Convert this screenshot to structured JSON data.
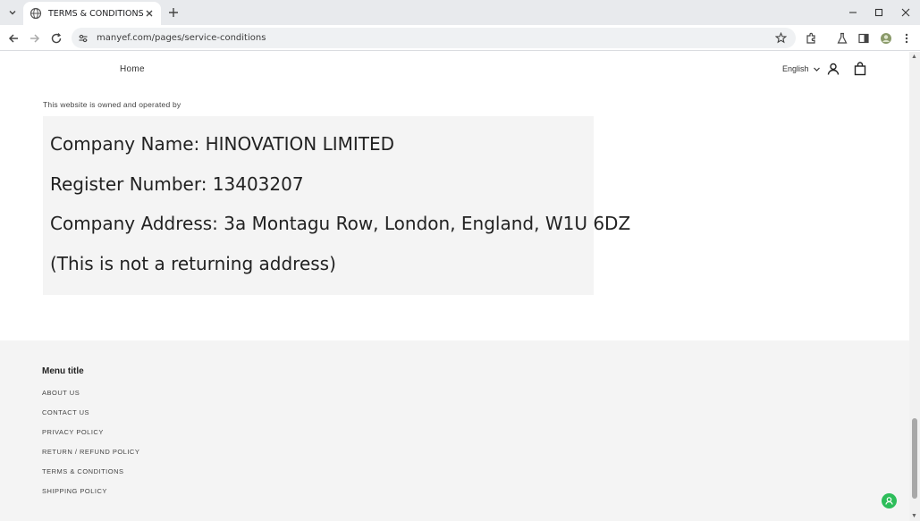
{
  "browser": {
    "tab_title": "TERMS & CONDITIONS",
    "url": "manyef.com/pages/service-conditions"
  },
  "header": {
    "nav_home": "Home",
    "language": "English"
  },
  "content": {
    "owned_text": "This website is owned and operated by",
    "company_lines": [
      "Company Name: HINOVATION LIMITED",
      "Register Number: 13403207",
      "Company Address: 3a Montagu Row, London, England, W1U 6DZ",
      "(This is not a returning address)"
    ]
  },
  "footer": {
    "menu_title": "Menu title",
    "links": [
      "ABOUT US",
      "CONTACT US",
      "PRIVACY POLICY",
      "RETURN / REFUND POLICY",
      "TERMS & CONDITIONS",
      "SHIPPING POLICY"
    ]
  },
  "icons": {
    "tab_favicon": "globe-icon",
    "chat": "chat-icon",
    "account": "account-icon",
    "cart": "bag-icon"
  },
  "colors": {
    "chat_green": "#2dbd5a",
    "footer_bg": "#f4f4f4"
  }
}
